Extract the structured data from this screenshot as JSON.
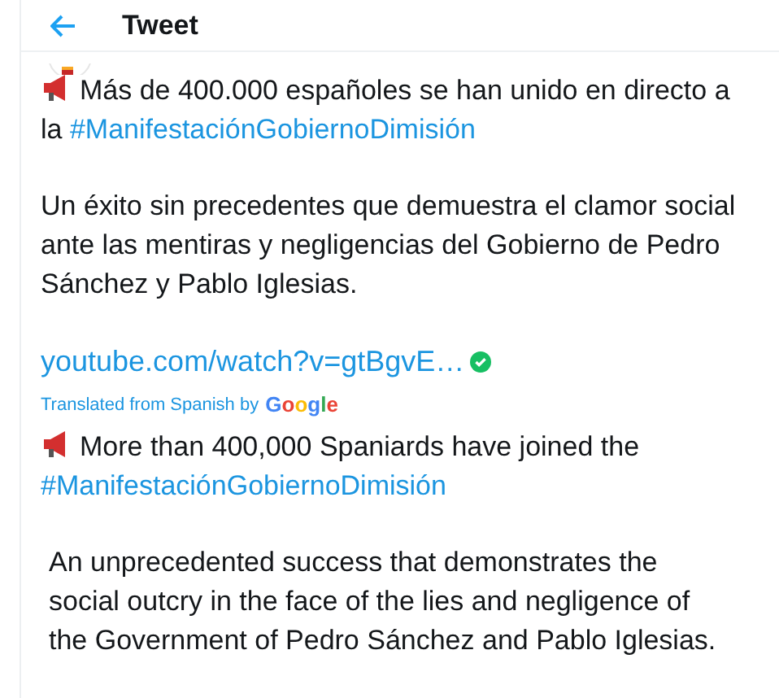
{
  "header": {
    "title": "Tweet"
  },
  "original": [
    {
      "kind": "announcement",
      "segments": [
        {
          "kind": "text",
          "text": "Más de 400.000 españoles se han unido en directo a la "
        },
        {
          "kind": "hashtag",
          "text": "#ManifestaciónGobiernoDimisión"
        }
      ]
    },
    {
      "kind": "plain",
      "segments": [
        {
          "kind": "text",
          "text": "Un éxito sin precedentes que demuestra el clamor social ante las mentiras y negligencias del Gobierno de Pedro Sánchez y Pablo Iglesias."
        }
      ]
    }
  ],
  "link": {
    "text": "youtube.com/watch?v=gtBgvE…",
    "verified": true
  },
  "translation": {
    "label": "Translated from Spanish by",
    "provider": "Google"
  },
  "translated": [
    {
      "kind": "announcement",
      "segments": [
        {
          "kind": "text",
          "text": "More than 400,000 Spaniards have joined the "
        },
        {
          "kind": "hashtag",
          "text": "#ManifestaciónGobiernoDimisión"
        }
      ]
    },
    {
      "kind": "plain",
      "segments": [
        {
          "kind": "text",
          "text": "An unprecedented success that demonstrates the social outcry in the face of the lies and negligence of the Government of Pedro Sánchez and Pablo Iglesias."
        }
      ]
    }
  ]
}
